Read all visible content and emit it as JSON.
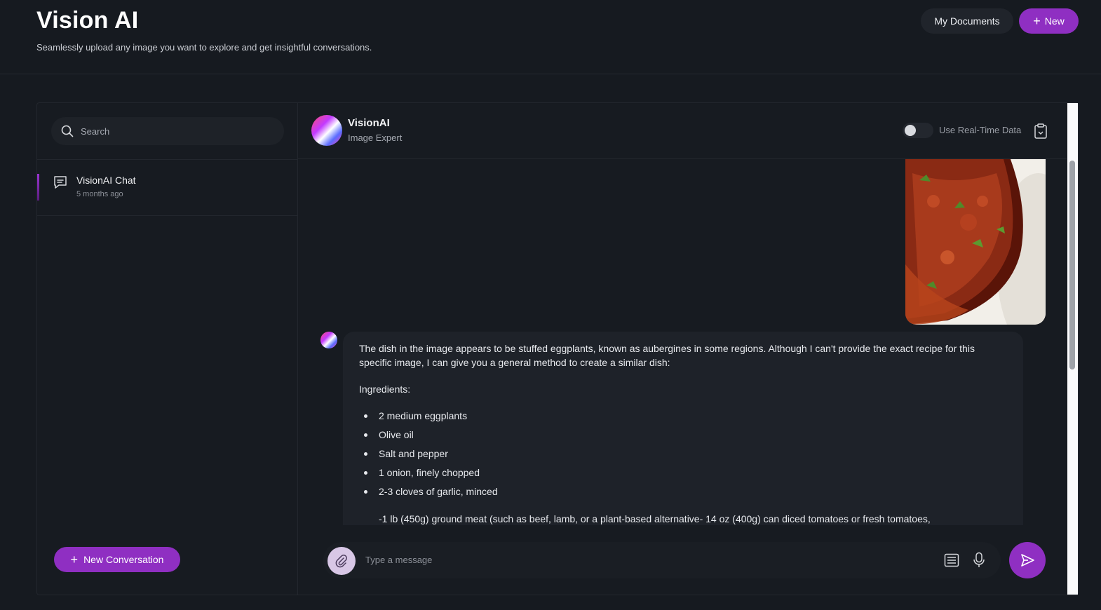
{
  "header": {
    "title": "Vision AI",
    "subtitle": "Seamlessly upload any image you want to explore and get insightful conversations.",
    "my_documents_label": "My Documents",
    "new_label": "New"
  },
  "sidebar": {
    "search_placeholder": "Search",
    "conversations": [
      {
        "title": "VisionAI Chat",
        "time": "5 months ago"
      }
    ],
    "new_conversation_label": "New Conversation"
  },
  "chat": {
    "bot_name": "VisionAI",
    "bot_role": "Image Expert",
    "realtime_label": "Use Real-Time Data",
    "realtime_enabled": false,
    "message": {
      "intro": "The dish in the image appears to be stuffed eggplants, known as aubergines in some regions. Although I can't provide the exact recipe for this specific image, I can give you a general method to create a similar dish:",
      "ingredients_heading": "Ingredients:",
      "ingredients": [
        "2 medium eggplants",
        "Olive oil",
        "Salt and pepper",
        "1 onion, finely chopped",
        "2-3 cloves of garlic, minced"
      ],
      "continuation": "-1 lb (450g) ground meat (such as beef, lamb, or a plant-based alternative- 14 oz (400g) can diced tomatoes or fresh tomatoes,"
    },
    "composer_placeholder": "Type a message"
  },
  "icons": {
    "search": "search-icon",
    "chat": "chat-bubble-icon",
    "clipboard": "clipboard-icon",
    "attach": "paperclip-icon",
    "document": "document-lines-icon",
    "mic": "microphone-icon",
    "send": "send-icon",
    "plus": "plus-icon"
  },
  "colors": {
    "background": "#161a20",
    "accent": "#8f2fc2",
    "panel_border": "#23272e",
    "bubble": "#1e2229"
  }
}
